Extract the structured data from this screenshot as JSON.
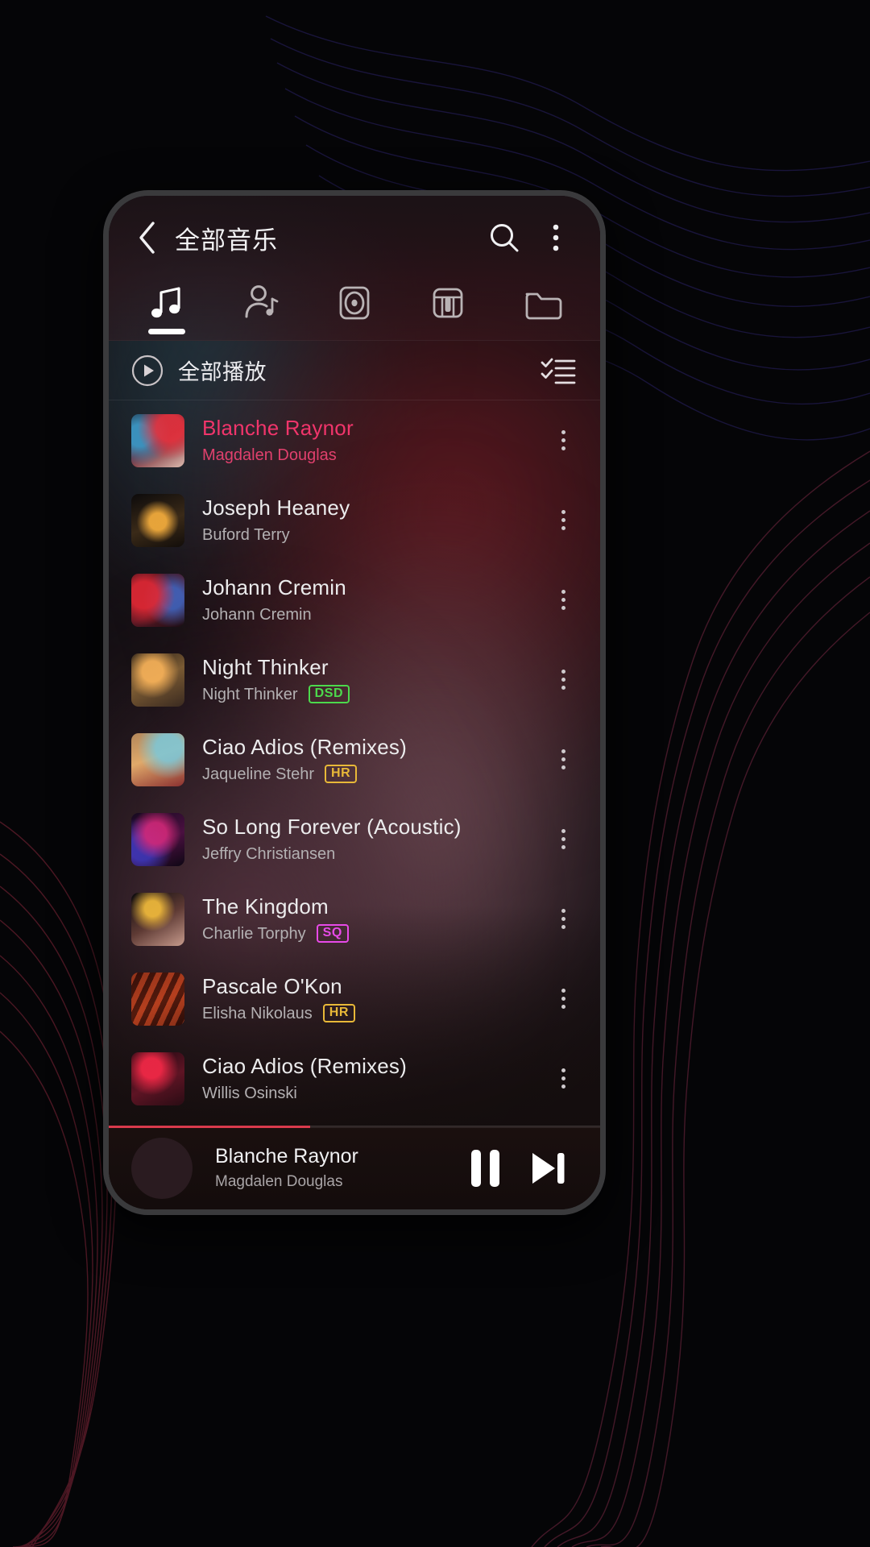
{
  "header": {
    "back_icon": "chevron-left-icon",
    "title": "全部音乐",
    "search_icon": "search-icon",
    "overflow_icon": "more-vertical-icon"
  },
  "tabs": [
    {
      "id": "songs",
      "icon": "music-note-icon",
      "active": true
    },
    {
      "id": "artists",
      "icon": "artist-icon",
      "active": false
    },
    {
      "id": "albums",
      "icon": "album-disc-icon",
      "active": false
    },
    {
      "id": "genres",
      "icon": "piano-keys-icon",
      "active": false
    },
    {
      "id": "folders",
      "icon": "folder-icon",
      "active": false
    }
  ],
  "playall": {
    "icon": "play-circle-icon",
    "label": "全部播放",
    "multiselect_icon": "checklist-icon"
  },
  "songs": [
    {
      "title": "Blanche Raynor",
      "artist": "Magdalen Douglas",
      "badge": "",
      "playing": true,
      "art": "art-a"
    },
    {
      "title": "Joseph Heaney",
      "artist": "Buford Terry",
      "badge": "",
      "playing": false,
      "art": "art-b"
    },
    {
      "title": "Johann Cremin",
      "artist": "Johann Cremin",
      "badge": "",
      "playing": false,
      "art": "art-c"
    },
    {
      "title": "Night Thinker",
      "artist": "Night Thinker",
      "badge": "DSD",
      "playing": false,
      "art": "art-d"
    },
    {
      "title": "Ciao Adios (Remixes)",
      "artist": "Jaqueline Stehr",
      "badge": "HR",
      "playing": false,
      "art": "art-e"
    },
    {
      "title": "So Long Forever (Acoustic)",
      "artist": "Jeffry Christiansen",
      "badge": "",
      "playing": false,
      "art": "art-f"
    },
    {
      "title": "The Kingdom",
      "artist": "Charlie Torphy",
      "badge": "SQ",
      "playing": false,
      "art": "art-g"
    },
    {
      "title": "Pascale O'Kon",
      "artist": "Elisha Nikolaus",
      "badge": "HR",
      "playing": false,
      "art": "art-h"
    },
    {
      "title": "Ciao Adios (Remixes)",
      "artist": "Willis Osinski",
      "badge": "",
      "playing": false,
      "art": "art-i"
    }
  ],
  "now_playing": {
    "title": "Blanche Raynor",
    "artist": "Magdalen Douglas",
    "pause_icon": "pause-icon",
    "next_icon": "skip-next-icon",
    "progress_percent": 41
  },
  "colors": {
    "accent_playing": "#f0356b",
    "badge_dsd": "#4cd94c",
    "badge_hr": "#e8b838",
    "badge_sq": "#e84ae8",
    "progress": "#d93a4c",
    "text_primary": "#ececed",
    "text_secondary": "#b3b0b2"
  }
}
